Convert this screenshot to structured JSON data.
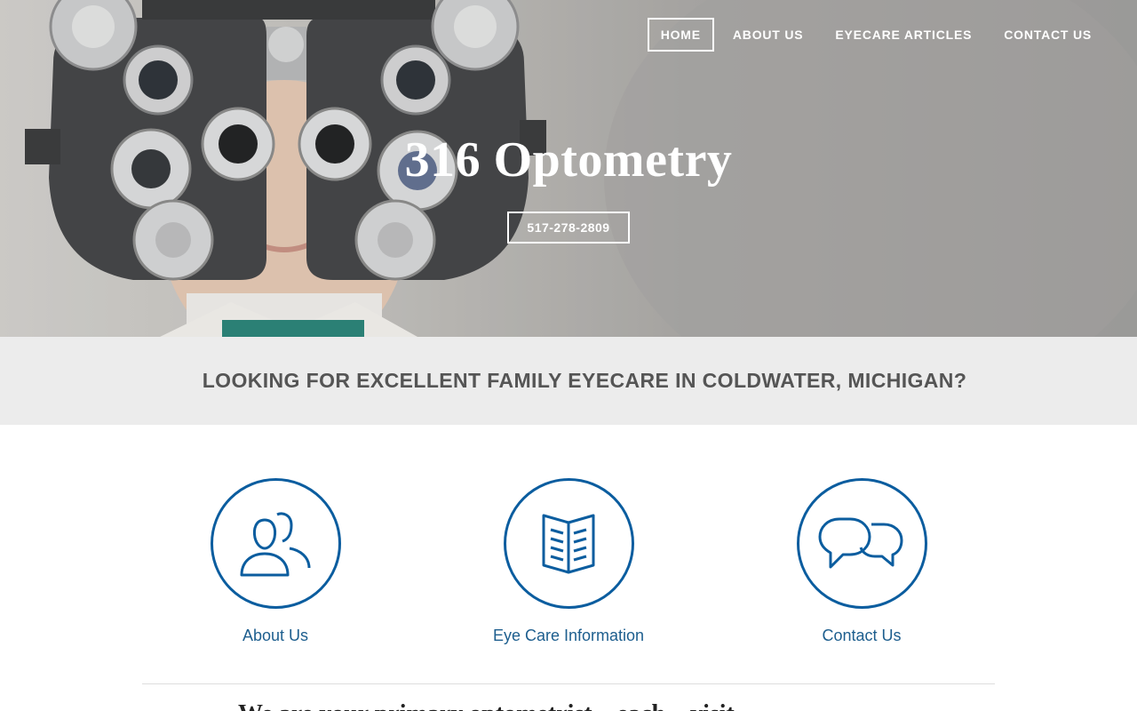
{
  "nav": {
    "items": [
      {
        "label": "HOME",
        "active": true
      },
      {
        "label": "ABOUT US",
        "active": false
      },
      {
        "label": "EYECARE ARTICLES",
        "active": false
      },
      {
        "label": "CONTACT US",
        "active": false
      }
    ]
  },
  "hero": {
    "title": "316 Optometry",
    "phone": "517-278-2809"
  },
  "banner": {
    "heading": "LOOKING FOR EXCELLENT FAMILY EYECARE IN COLDWATER, MICHIGAN?"
  },
  "features": [
    {
      "label": "About Us",
      "icon": "people-icon"
    },
    {
      "label": "Eye Care Information",
      "icon": "book-icon"
    },
    {
      "label": "Contact Us",
      "icon": "chat-bubbles-icon"
    }
  ],
  "intro": {
    "partial_text": "We are your primary optometrist... each... visit"
  },
  "colors": {
    "accent": "#0b5d9f",
    "banner_bg": "#ececec",
    "banner_text": "#555555"
  }
}
